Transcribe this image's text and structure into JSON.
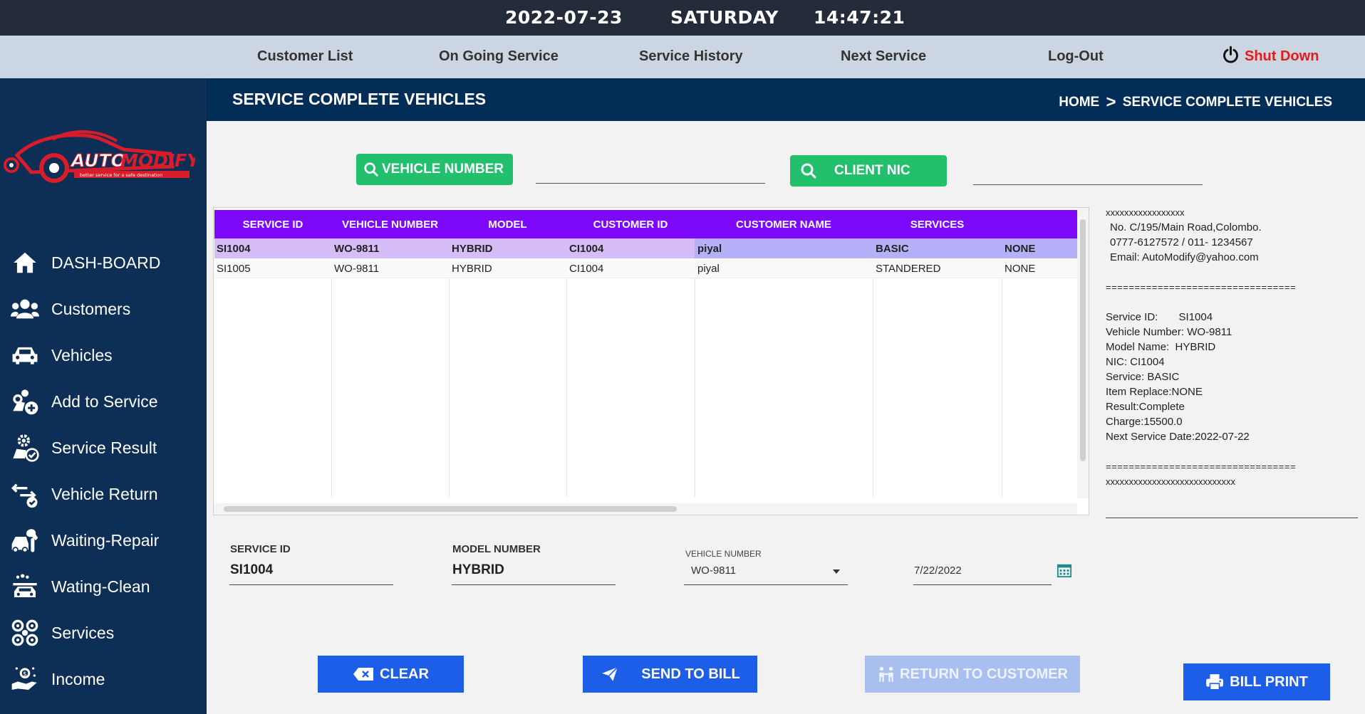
{
  "topbar": {
    "date": "2022-07-23",
    "day": "SATURDAY",
    "time": "14:47:21"
  },
  "nav": {
    "customer_list": "Customer List",
    "ongoing_service": "On Going Service",
    "service_history": "Service History",
    "next_service": "Next Service",
    "logout": "Log-Out",
    "shutdown": "Shut Down"
  },
  "logo": {
    "brand_part1": "AUTO",
    "brand_part2": "MODIFY",
    "tagline": "better service for a safe destination"
  },
  "sidebar": {
    "items": [
      {
        "label": "DASH-BOARD",
        "icon": "home-icon"
      },
      {
        "label": "Customers",
        "icon": "users-icon"
      },
      {
        "label": "Vehicles",
        "icon": "car-icon"
      },
      {
        "label": "Add to Service",
        "icon": "add-service-icon"
      },
      {
        "label": "Service Result",
        "icon": "service-result-icon"
      },
      {
        "label": "Vehicle Return",
        "icon": "return-icon"
      },
      {
        "label": "Waiting-Repair",
        "icon": "repair-icon"
      },
      {
        "label": "Wating-Clean",
        "icon": "clean-icon"
      },
      {
        "label": "Services",
        "icon": "services-icon"
      },
      {
        "label": "Income",
        "icon": "income-icon"
      }
    ]
  },
  "header": {
    "title": "SERVICE COMPLETE VEHICLES",
    "breadcrumb_home": "HOME",
    "breadcrumb_sep": ">",
    "breadcrumb_current": "SERVICE COMPLETE VEHICLES"
  },
  "search": {
    "vehicle_label": "VEHICLE NUMBER",
    "vehicle_value": "",
    "nic_label": "CLIENT NIC",
    "nic_value": ""
  },
  "table": {
    "columns": [
      "SERVICE ID",
      "VEHICLE NUMBER",
      "MODEL",
      "CUSTOMER ID",
      "CUSTOMER NAME",
      "SERVICES",
      ""
    ],
    "rows": [
      [
        "SI1004",
        "WO-9811",
        "HYBRID",
        "CI1004",
        "piyal",
        "BASIC",
        "NONE"
      ],
      [
        "SI1005",
        "WO-9811",
        "HYBRID",
        "CI1004",
        "piyal",
        "STANDERED",
        "NONE"
      ]
    ],
    "selected_row": 0
  },
  "receipt": {
    "lines": [
      "xxxxxxxxxxxxxxxxx",
      " No. C/195/Main Road,Colombo.",
      " 0777-6127572 / 011- 1234567",
      " Email: AutoModify@yahoo.com",
      "",
      "=================================",
      "",
      "Service ID:       SI1004",
      "Vehicle Number: WO-9811",
      "Model Name:  HYBRID",
      "NIC: CI1004",
      "Service: BASIC",
      "Item Replace:NONE",
      "Result:Complete",
      "Charge:15500.0",
      "Next Service Date:2022-07-22",
      "",
      "=================================",
      "xxxxxxxxxxxxxxxxxxxxxxxxxxxx"
    ]
  },
  "form": {
    "service_id_label": "SERVICE ID",
    "service_id_value": "SI1004",
    "model_label": "MODEL NUMBER",
    "model_value": "HYBRID",
    "vehicle_label": "VEHICLE NUMBER",
    "vehicle_value": "WO-9811",
    "date_value": "7/22/2022"
  },
  "buttons": {
    "clear": "CLEAR",
    "send_to_bill": "SEND TO BILL",
    "return_to_customer": "RETURN TO CUSTOMER",
    "bill_print": "BILL PRINT"
  },
  "colors": {
    "accent_green": "#22bf6c",
    "header_purple": "#7d08fc",
    "button_blue": "#1d5ee8",
    "sidebar_navy": "#0d2e55",
    "shutdown_red": "#e31b1b"
  }
}
